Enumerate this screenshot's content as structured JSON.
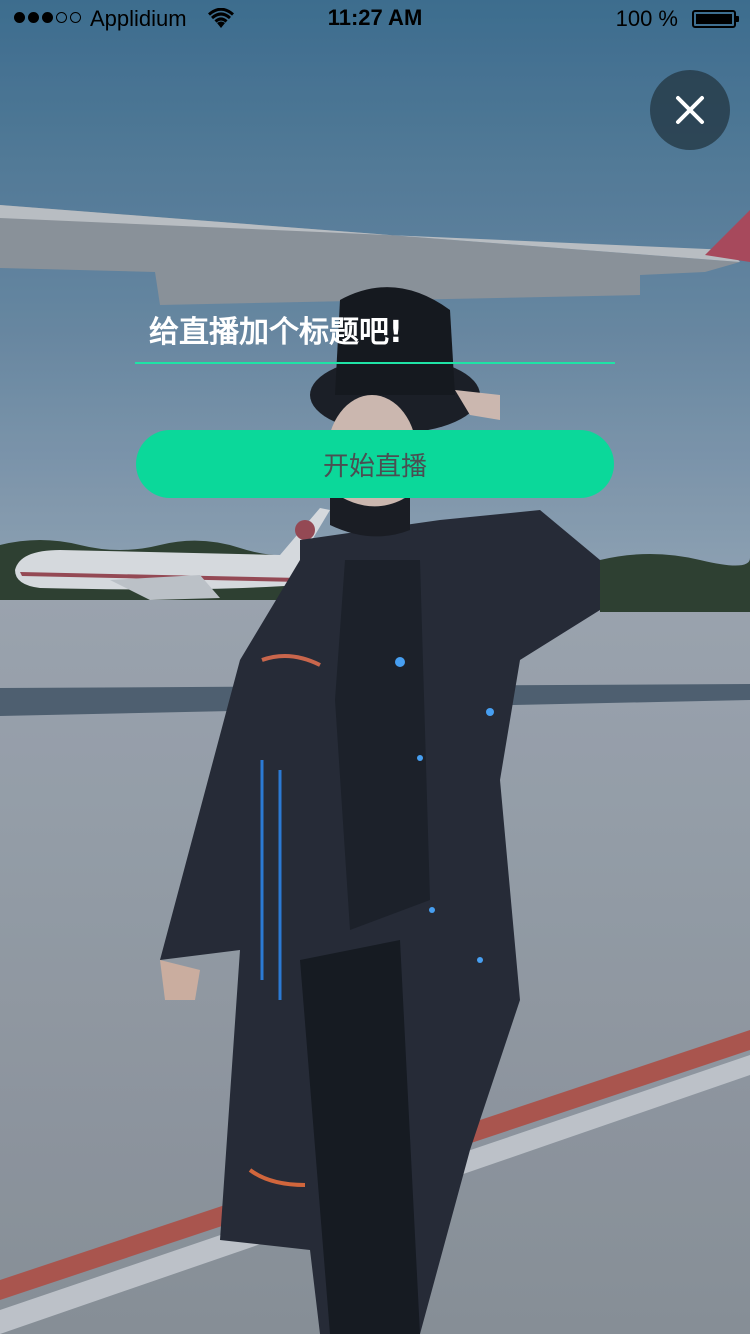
{
  "status_bar": {
    "carrier": "Applidium",
    "time": "11:27 AM",
    "battery": "100 %"
  },
  "close": {
    "icon": "close-icon"
  },
  "title_input": {
    "placeholder": "给直播加个标题吧!",
    "value": ""
  },
  "start_button": {
    "label": "开始直播"
  },
  "colors": {
    "accent": "#0bd89a",
    "underline": "#1fe3a6",
    "close_bg": "#263a48"
  }
}
